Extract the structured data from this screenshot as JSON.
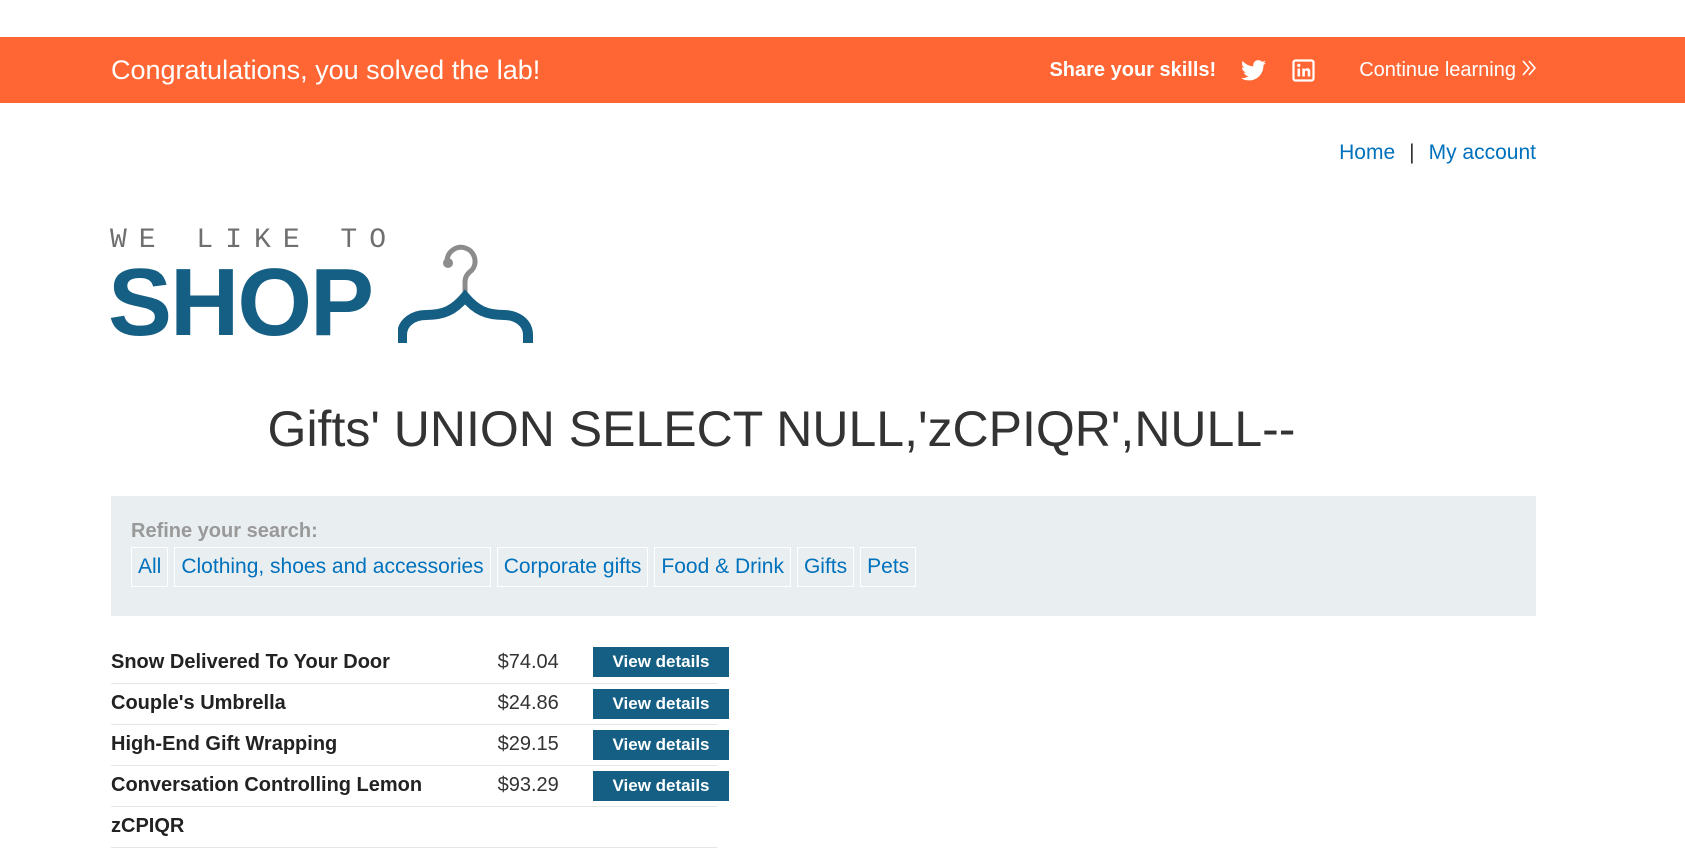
{
  "banner": {
    "title": "Congratulations, you solved the lab!",
    "share_label": "Share your skills!",
    "twitter_icon": "twitter-icon",
    "linkedin_icon": "linkedin-icon",
    "continue_label": "Continue learning",
    "continue_icon": "double-chevron-right-icon",
    "background_color": "#ff6633"
  },
  "nav": {
    "home": "Home",
    "separator": "|",
    "account": "My account"
  },
  "logo": {
    "top_text": "WE LIKE TO",
    "main_text": "SHOP",
    "icon": "hanger-icon",
    "brand_color": "#155f84"
  },
  "page": {
    "title": "Gifts' UNION SELECT NULL,'zCPIQR',NULL--"
  },
  "filters": {
    "label": "Refine your search:",
    "items": [
      "All",
      "Clothing, shoes and accessories",
      "Corporate gifts",
      "Food & Drink",
      "Gifts",
      "Pets"
    ]
  },
  "products": [
    {
      "name": "Snow Delivered To Your Door",
      "price": "$74.04",
      "action": "View details"
    },
    {
      "name": "Couple's Umbrella",
      "price": "$24.86",
      "action": "View details"
    },
    {
      "name": "High-End Gift Wrapping",
      "price": "$29.15",
      "action": "View details"
    },
    {
      "name": "Conversation Controlling Lemon",
      "price": "$93.29",
      "action": "View details"
    },
    {
      "name": "zCPIQR",
      "price": "",
      "action": ""
    }
  ],
  "colors": {
    "link": "#0071bc",
    "button": "#155f84",
    "panel": "#e9eef1"
  }
}
